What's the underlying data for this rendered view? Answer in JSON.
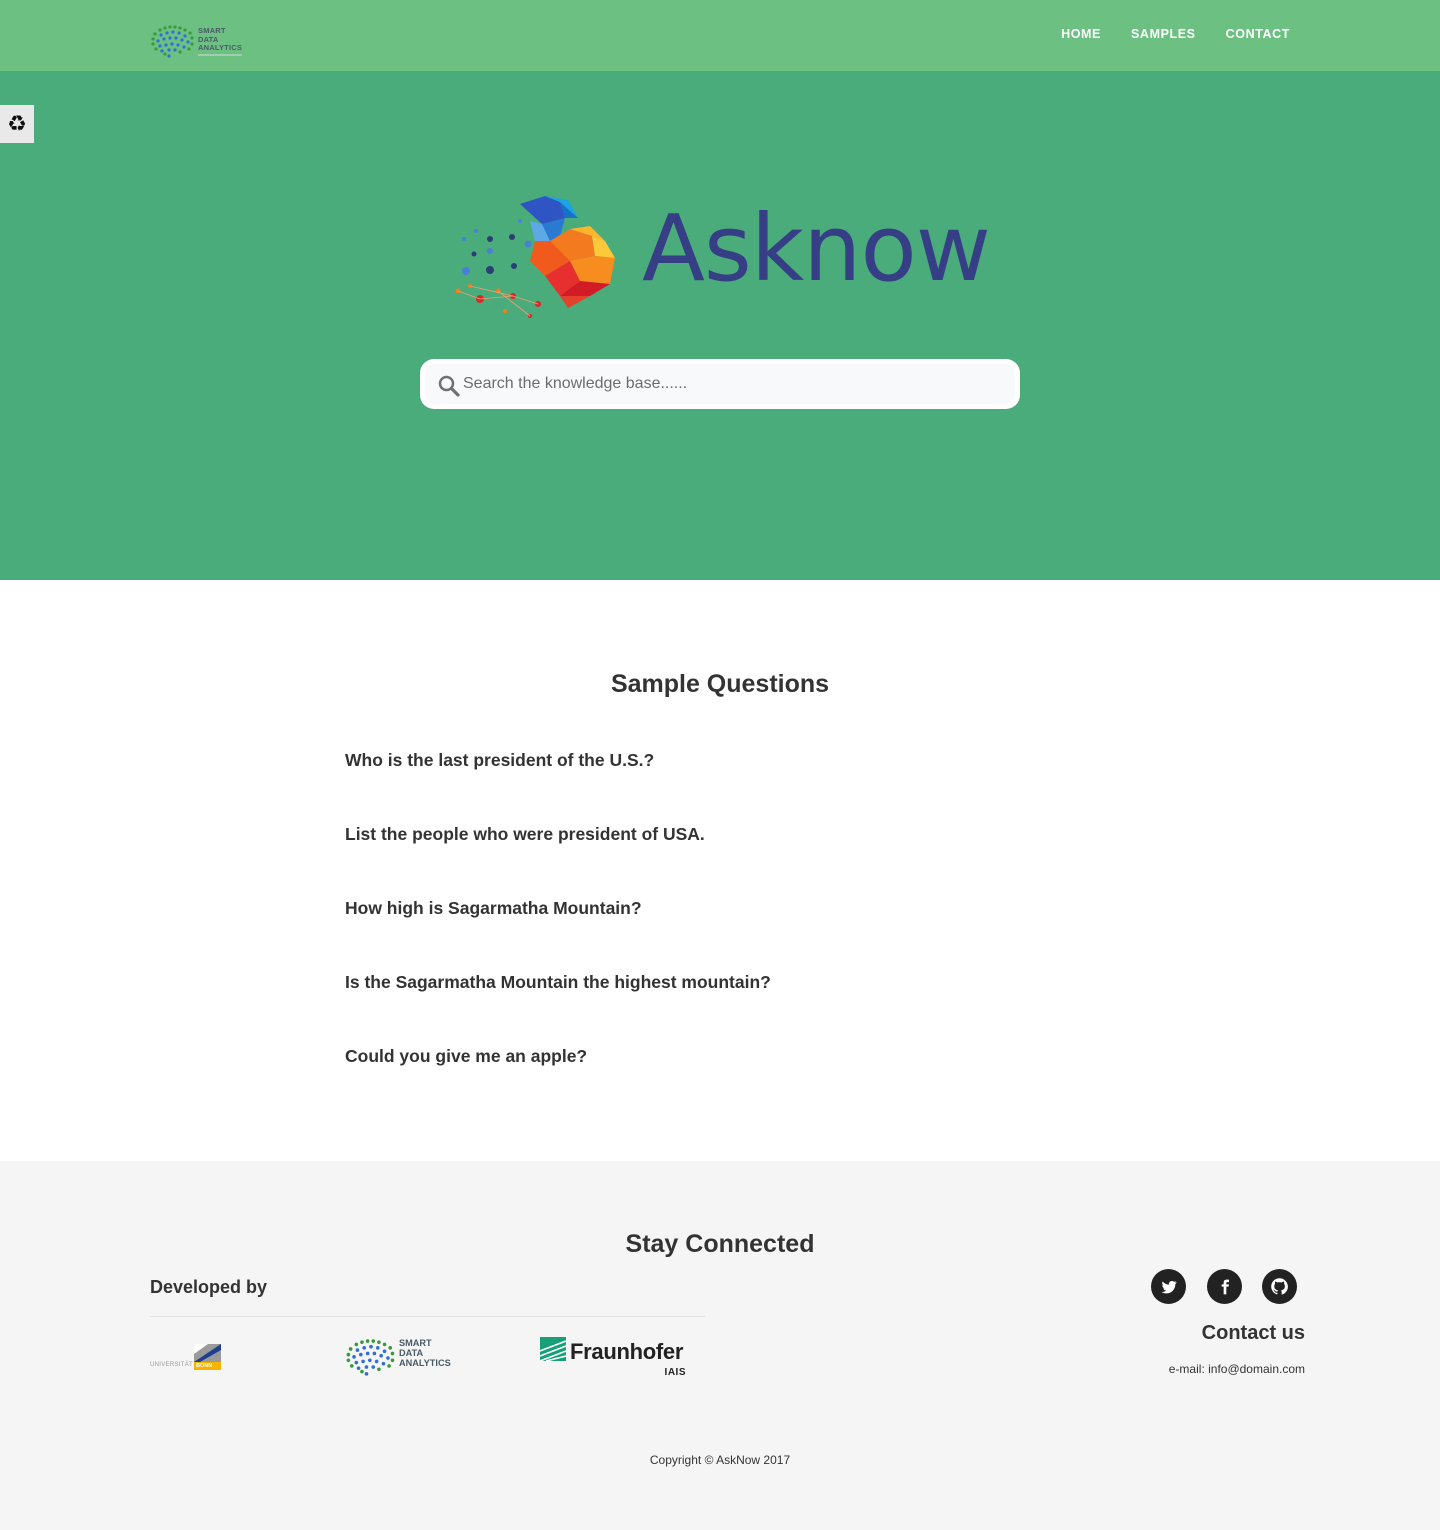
{
  "navbar": {
    "brand_lines": [
      "SMART",
      "DATA",
      "ANALYTICS"
    ],
    "links": [
      "HOME",
      "SAMPLES",
      "CONTACT"
    ]
  },
  "side_widget": {
    "icon": "recycle-icon",
    "glyph": "♻"
  },
  "hero": {
    "title": "Asknow",
    "search": {
      "placeholder": "Search the knowledge base......",
      "value": ""
    }
  },
  "samples": {
    "title": "Sample Questions",
    "questions": [
      "Who is the last president of the U.S.?",
      "List the people who were president of USA.",
      "How high is Sagarmatha Mountain?",
      "Is the Sagarmatha Mountain the highest mountain?",
      "Could you give me an apple?"
    ]
  },
  "footer": {
    "title": "Stay Connected",
    "developed_by": "Developed by",
    "partners": {
      "bonn": {
        "text": "UNIVERSITÄT",
        "badge": "BONN"
      },
      "sda": {
        "lines": [
          "SMART",
          "DATA",
          "ANALYTICS"
        ]
      },
      "fraunhofer": {
        "name": "Fraunhofer",
        "sub": "IAIS"
      }
    },
    "social": [
      "twitter-icon",
      "facebook-icon",
      "github-icon"
    ],
    "contact_title": "Contact us",
    "contact_email": "e-mail: info@domain.com",
    "copyright": "Copyright © AskNow 2017"
  },
  "colors": {
    "navbar": "#6cc081",
    "hero": "#4aac7a",
    "title": "#363f86",
    "footer": "#f5f5f5"
  }
}
